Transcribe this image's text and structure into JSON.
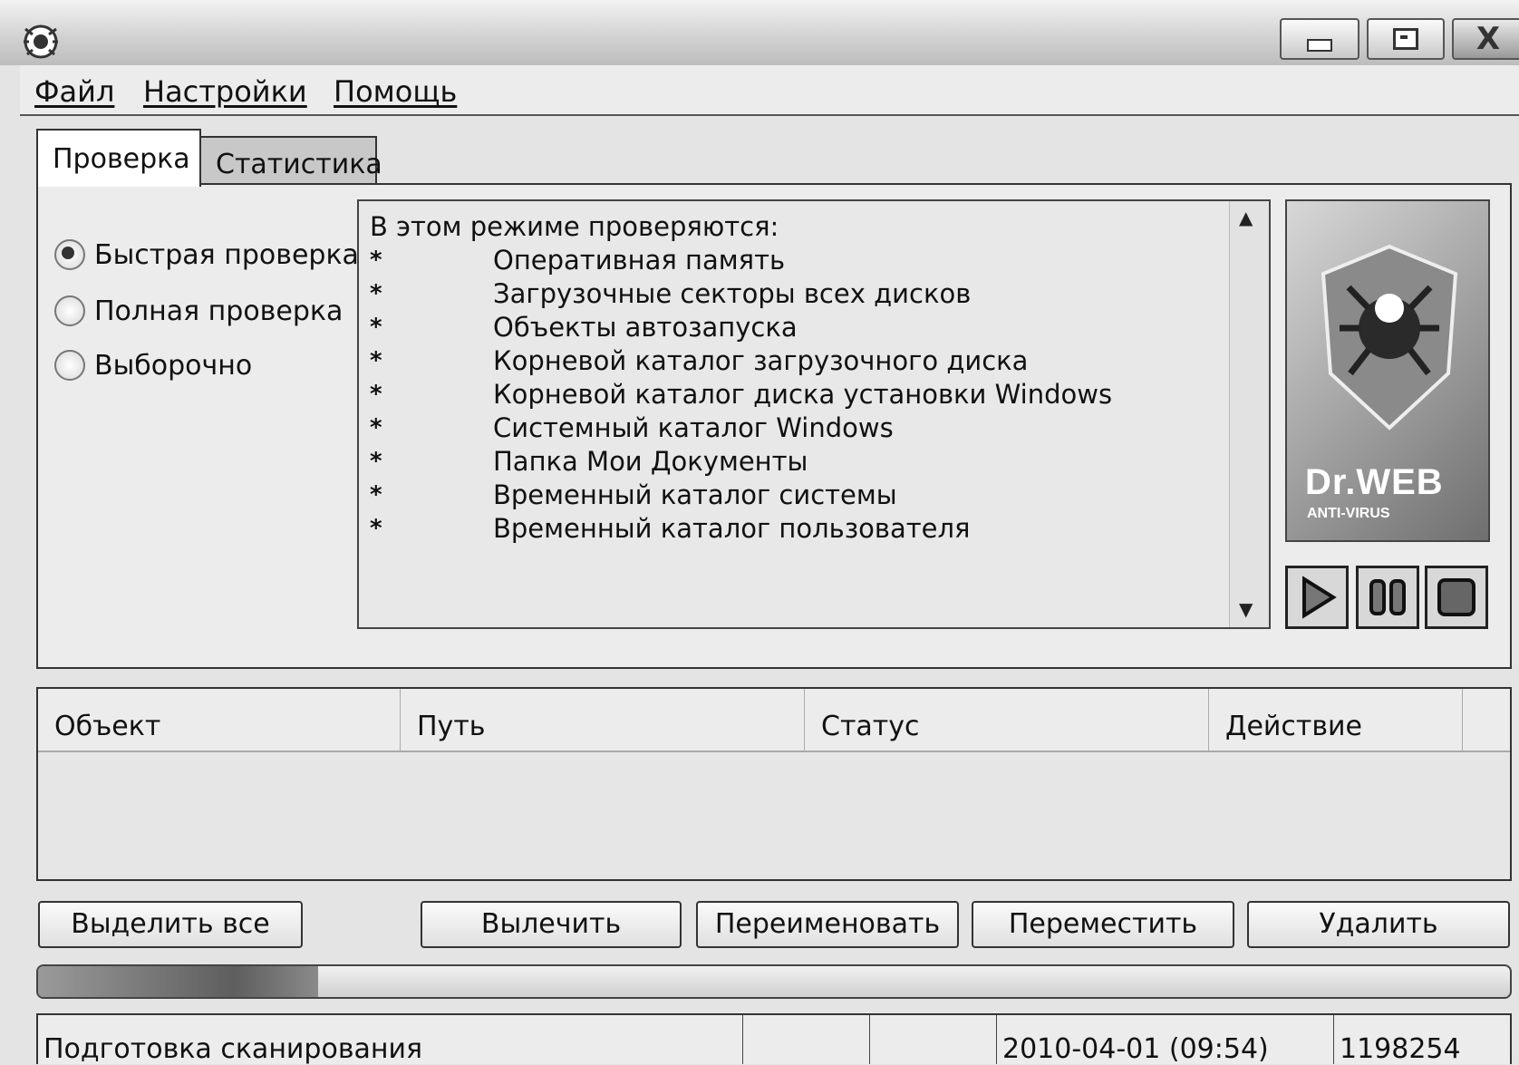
{
  "window": {
    "app_icon": "drweb-spider-icon",
    "controls": {
      "minimize_icon": "minimize-icon",
      "maximize_icon": "maximize-icon",
      "close_icon": "close-icon",
      "close_glyph": "X"
    }
  },
  "menu": {
    "items": [
      {
        "label": "Файл"
      },
      {
        "label": "Настройки"
      },
      {
        "label": "Помощь"
      }
    ]
  },
  "tabs": [
    {
      "label": "Проверка",
      "active": true
    },
    {
      "label": "Статистика",
      "active": false
    }
  ],
  "scan_modes": [
    {
      "label": "Быстрая проверка",
      "selected": true
    },
    {
      "label": "Полная проверка",
      "selected": false
    },
    {
      "label": "Выборочно",
      "selected": false
    }
  ],
  "description": {
    "heading": "В этом режиме проверяются:",
    "bullet": "*",
    "items": [
      "Оперативная память",
      "Загрузочные секторы всех дисков",
      "Объекты автозапуска",
      "Корневой каталог загрузочного диска",
      "Корневой каталог диска установки Windows",
      "Системный каталог Windows",
      "Папка Мои Документы",
      "Временный каталог системы",
      "Временный каталог пользователя"
    ]
  },
  "logo": {
    "brand": "Dr.WEB",
    "subtitle": "ANTI-VIRUS"
  },
  "scan_controls": {
    "play_icon": "play-icon",
    "pause_icon": "pause-icon",
    "stop_icon": "stop-icon"
  },
  "results_table": {
    "columns": [
      "Объект",
      "Путь",
      "Статус",
      "Действие"
    ],
    "rows": []
  },
  "actions": {
    "select_all": "Выделить все",
    "cure": "Вылечить",
    "rename": "Переименовать",
    "move": "Переместить",
    "delete": "Удалить"
  },
  "progress": {
    "fraction": 0.19
  },
  "status_bar": {
    "message": "Подготовка сканирования",
    "cell2": "",
    "cell3": "",
    "datetime": "2010-04-01 (09:54)",
    "count": "1198254"
  }
}
